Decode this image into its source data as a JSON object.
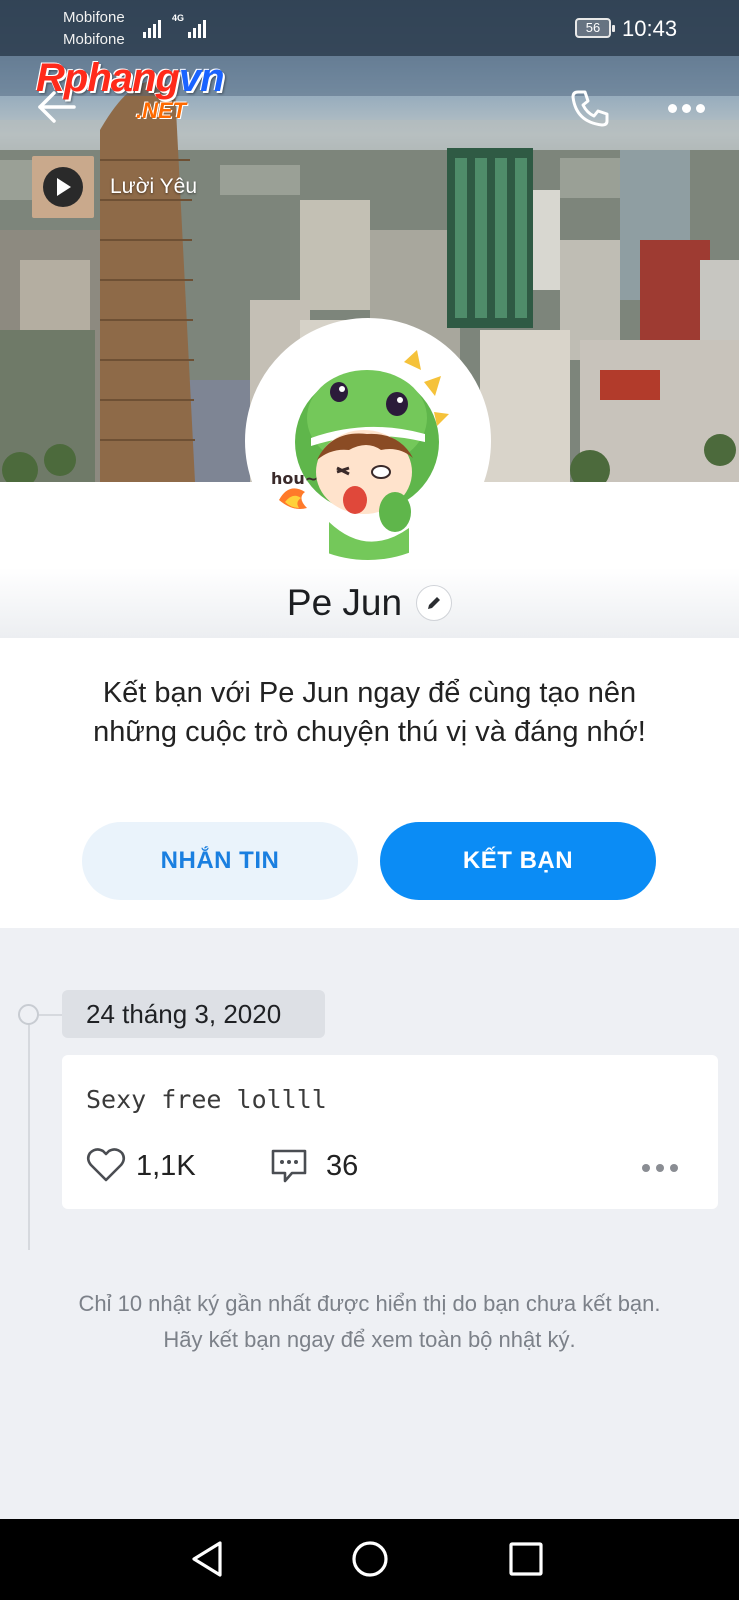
{
  "status_bar": {
    "carrier_1": "Mobifone",
    "carrier_2": "Mobifone",
    "network": "4G",
    "battery": "56",
    "time": "10:43"
  },
  "watermark": {
    "main_prefix": "Rphang",
    "main_suffix": "vn",
    "sub": ".NET"
  },
  "header": {
    "back_icon": "arrow-left-icon",
    "call_icon": "phone-icon",
    "more_icon": "more-horizontal-icon"
  },
  "music": {
    "title": "Lười Yêu",
    "play_icon": "play-icon"
  },
  "profile": {
    "name": "Pe Jun",
    "avatar_label": "hou~",
    "edit_icon": "pencil-icon"
  },
  "invite": {
    "message": "Kết bạn với Pe Jun ngay để cùng tạo nên những cuộc trò chuyện thú vị và đáng nhớ!",
    "message_button": "NHẮN TIN",
    "add_friend_button": "KẾT BẠN"
  },
  "timeline": {
    "date": "24 tháng 3, 2020",
    "post": {
      "text": "Sexy free lollll",
      "likes": "1,1K",
      "comments": "36"
    },
    "notice": "Chỉ 10 nhật ký gần nhất được hiển thị do bạn chưa kết bạn. Hãy kết bạn ngay để xem toàn bộ nhật ký."
  },
  "colors": {
    "primary": "#0b8cf5",
    "secondary_button_bg": "#eaf3fb",
    "page_bg": "#eef0f4"
  }
}
